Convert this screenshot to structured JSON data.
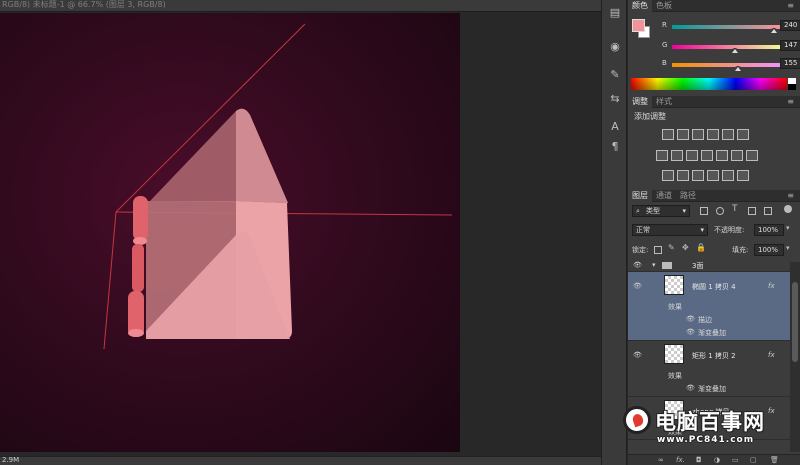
{
  "document": {
    "tab_title": "RGB/8) 未标题-1 @ 66.7% (图层 3, RGB/8)",
    "status": "2.9M"
  },
  "color_panel": {
    "tabs": [
      "颜色",
      "色板"
    ],
    "foreground": "#f0939b",
    "background": "#ffffff",
    "sliders": [
      {
        "label": "R",
        "value": "240",
        "fraction": 0.94,
        "track": "linear-gradient(to right,#009b9b,#ff939b)"
      },
      {
        "label": "G",
        "value": "147",
        "fraction": 0.58,
        "track": "linear-gradient(to right,#f0009b,#f0ff9b)"
      },
      {
        "label": "B",
        "value": "155",
        "fraction": 0.61,
        "track": "linear-gradient(to right,#f09300,#f093ff)"
      }
    ]
  },
  "adjustments_panel": {
    "tabs": [
      "调整",
      "样式"
    ],
    "title": "添加调整"
  },
  "layers_panel": {
    "tabs": [
      "图层",
      "通道",
      "路径"
    ],
    "filter_kind": "类型",
    "blend_mode": "正常",
    "opacity_label": "不透明度:",
    "opacity_value": "100%",
    "lock_label": "锁定:",
    "fill_label": "填充:",
    "fill_value": "100%",
    "group_name": "3面",
    "layers": [
      {
        "name": "椭圆 1 拷贝 4",
        "fx": "fx",
        "selected": true,
        "effects_label": "效果",
        "effects": [
          "描边",
          "渐变叠加"
        ]
      },
      {
        "name": "矩形 1 拷贝 2",
        "fx": "fx",
        "selected": false,
        "effects_label": "效果",
        "effects": [
          "渐变叠加"
        ]
      },
      {
        "name": "zhong 拷贝",
        "fx": "fx",
        "selected": false,
        "effects_label": "效果",
        "effects": []
      }
    ],
    "bottom_icons": [
      "link-icon",
      "fx-icon",
      "mask-icon",
      "adjustment-icon",
      "folder-icon",
      "new-layer-icon",
      "trash-icon"
    ]
  },
  "watermark": {
    "title": "电脑百事网",
    "url": "www.PC841.com"
  }
}
